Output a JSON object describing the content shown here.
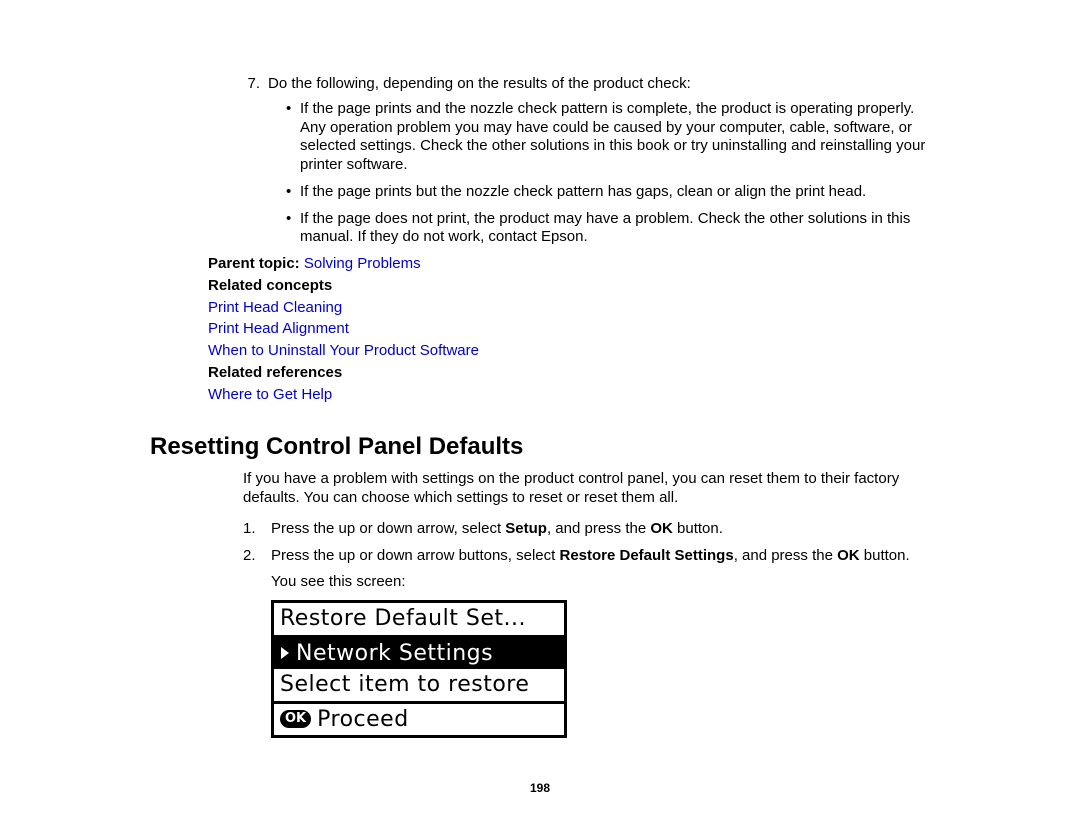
{
  "upper": {
    "step_num": "7.",
    "step_text": "Do the following, depending on the results of the product check:",
    "bullets": [
      "If the page prints and the nozzle check pattern is complete, the product is operating properly. Any operation problem you may have could be caused by your computer, cable, software, or selected settings. Check the other solutions in this book or try uninstalling and reinstalling your printer software.",
      "If the page prints but the nozzle check pattern has gaps, clean or align the print head.",
      "If the page does not print, the product may have a problem. Check the other solutions in this manual. If they do not work, contact Epson."
    ],
    "parent_label": "Parent topic:",
    "parent_link": "Solving Problems",
    "related_concepts_label": "Related concepts",
    "concepts": [
      "Print Head Cleaning",
      "Print Head Alignment",
      "When to Uninstall Your Product Software"
    ],
    "related_refs_label": "Related references",
    "refs": [
      "Where to Get Help"
    ]
  },
  "section": {
    "title": "Resetting Control Panel Defaults",
    "intro": "If you have a problem with settings on the product control panel, you can reset them to their factory defaults. You can choose which settings to reset or reset them all.",
    "steps": {
      "s1": {
        "num": "1.",
        "pre": "Press the up or down arrow, select ",
        "b1": "Setup",
        "mid": ", and press the ",
        "b2": "OK",
        "post": " button."
      },
      "s2": {
        "num": "2.",
        "pre": "Press the up or down arrow buttons, select ",
        "b1": "Restore Default Settings",
        "mid": ", and press the ",
        "b2": "OK",
        "post": " button."
      }
    },
    "caption": "You see this screen:",
    "lcd": {
      "line1": "Restore Default Set...",
      "line2": "Network Settings",
      "line3": "Select item to restore",
      "ok": "OK",
      "line4": "Proceed"
    }
  },
  "page_num": "198"
}
